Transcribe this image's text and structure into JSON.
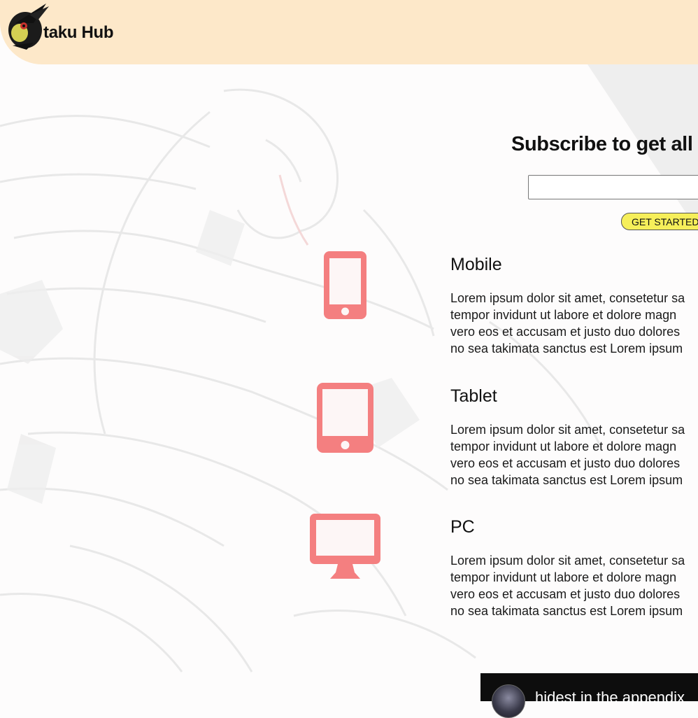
{
  "brand": {
    "name": "taku Hub"
  },
  "colors": {
    "header_bg": "#fde8c9",
    "icon_red": "#f47f80",
    "button_yellow": "#f6ef5a",
    "video_bg": "#0d0d0d"
  },
  "subscribe": {
    "title": "Subscribe to get all la",
    "input_placeholder": "",
    "button_label": "GET STARTED"
  },
  "features": [
    {
      "icon": "mobile-phone-icon",
      "title": "Mobile",
      "lines": [
        "Lorem ipsum dolor sit amet, consetetur sa",
        "tempor invidunt ut labore et dolore magn",
        "vero eos et accusam et justo duo dolores",
        "no sea takimata sanctus est Lorem ipsum"
      ]
    },
    {
      "icon": "tablet-icon",
      "title": "Tablet",
      "lines": [
        "Lorem ipsum dolor sit amet, consetetur sa",
        "tempor invidunt ut labore et dolore magn",
        "vero eos et accusam et justo duo dolores",
        "no sea takimata sanctus est Lorem ipsum"
      ]
    },
    {
      "icon": "desktop-monitor-icon",
      "title": "PC",
      "lines": [
        "Lorem ipsum dolor sit amet, consetetur sa",
        "tempor invidunt ut labore et dolore magn",
        "vero eos et accusam et justo duo dolores",
        "no sea takimata sanctus est Lorem ipsum"
      ]
    }
  ],
  "video": {
    "title": "hidest in the appendix"
  }
}
